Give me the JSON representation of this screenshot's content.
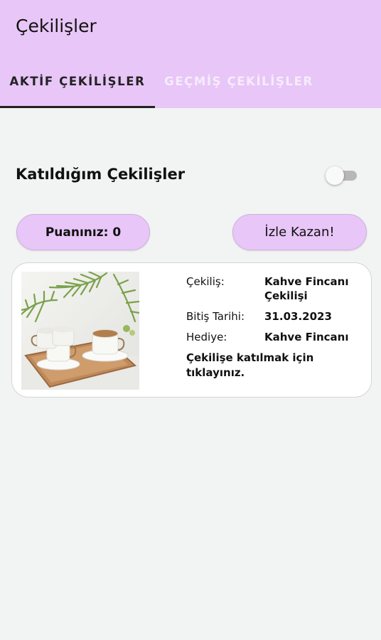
{
  "app": {
    "title": "Çekilişler"
  },
  "tabs": [
    {
      "label": "AKTİF ÇEKİLİŞLER",
      "active": true
    },
    {
      "label": "GEÇMİŞ ÇEKİLİŞLER",
      "active": false
    }
  ],
  "filter": {
    "label": "Katıldığım Çekilişler",
    "enabled": false
  },
  "buttons": {
    "score": "Puanınız: 0",
    "watch": "İzle Kazan!"
  },
  "raffle": {
    "image_icon": "coffee-cups-photo",
    "name_key": "Çekiliş:",
    "name_value": "Kahve Fincanı Çekilişi",
    "end_key": "Bitiş Tarihi:",
    "end_value": "31.03.2023",
    "prize_key": "Hediye:",
    "prize_value": "Kahve Fincanı",
    "cta": "Çekilişe katılmak için tıklayınız."
  },
  "colors": {
    "accent": "#e8c6f7",
    "background": "#f2f3f3"
  }
}
